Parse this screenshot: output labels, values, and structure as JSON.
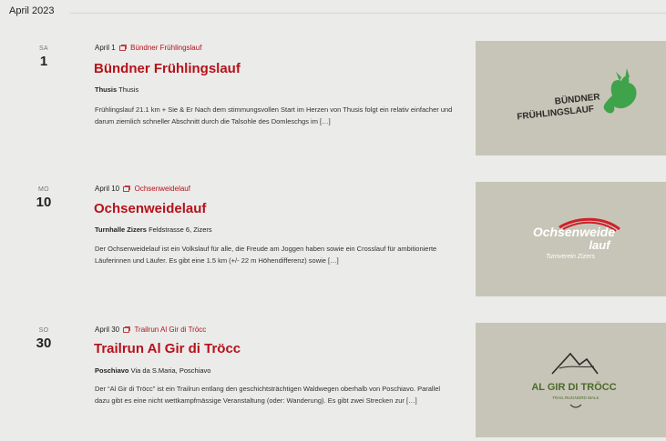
{
  "month": {
    "label": "April 2023"
  },
  "events": [
    {
      "dow": "SA",
      "day": "1",
      "date_label": "April 1",
      "category": "Bündner Frühlingslauf",
      "title": "Bündner Frühlingslauf",
      "venue_name": "Thusis",
      "venue_address": "Thusis",
      "description": "Frühlingslauf 21.1 km + Sie & Er Nach dem stimmungsvollen Start im Herzen von Thusis folgt ein relativ einfacher und darum ziemlich schneller Abschnitt durch die Talsohle des Domleschgs im […]",
      "image": {
        "line1": "BÜNDNER",
        "line2": "FRÜHLINGSLAUF"
      }
    },
    {
      "dow": "MO",
      "day": "10",
      "date_label": "April 10",
      "category": "Ochsenweidelauf",
      "title": "Ochsenweidelauf",
      "venue_name": "Turnhalle Zizers",
      "venue_address": "Feldstrasse 6, Zizers",
      "description": "Der Ochsenweidelauf ist ein Volkslauf für alle, die Freude am Joggen haben sowie ein Crosslauf für ambitionierte Läuferinnen und Läufer. Es gibt eine 1.5 km  (+/- 22 m Höhendifferenz) sowie […]",
      "image": {
        "line1": "Ochsenweide",
        "line2": "lauf",
        "line3": "Turnverein Zizers"
      }
    },
    {
      "dow": "SO",
      "day": "30",
      "date_label": "April 30",
      "category": "Trailrun Al Gir di Tröcc",
      "title": "Trailrun Al Gir di Tröcc",
      "venue_name": "Poschiavo",
      "venue_address": "Via da S.Maria, Poschiavo",
      "description": "Der “Al Gir di Tröcc” ist ein Trailrun entlang den geschichtsträchtigen Waldwegen oberhalb von Poschiavo. Parallel dazu gibt es eine nicht wettkampfmässige Veranstaltung (oder: Wanderung). Es gibt zwei Strecken zur […]",
      "image": {
        "line1": "AL GIR DI TRÖCC",
        "line2": "TRAIL RUN",
        "line3": "NORD WALK"
      }
    }
  ],
  "colors": {
    "accent": "#b5121b",
    "background": "#ebebe9",
    "thumb": "#c7c5b7"
  },
  "icons": {
    "category": "calendar-icon"
  }
}
